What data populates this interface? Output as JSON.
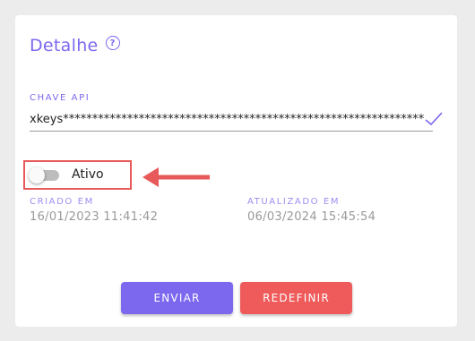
{
  "detail": {
    "title": "Detalhe",
    "help_icon": "question-circle-icon",
    "help_glyph": "?"
  },
  "api_key": {
    "label": "CHAVE API",
    "value": "xkeys**************************************************************"
  },
  "status": {
    "label": "Ativo",
    "enabled": false
  },
  "created": {
    "label": "CRIADO EM",
    "value": "16/01/2023 11:41:42"
  },
  "updated": {
    "label": "ATUALIZADO EM",
    "value": "06/03/2024 15:45:54"
  },
  "actions": {
    "send_label": "ENVIAR",
    "reset_label": "REDEFINIR"
  },
  "colors": {
    "accent": "#7b68ee",
    "danger": "#ef5b5b",
    "annotation": "#e85a5a"
  }
}
